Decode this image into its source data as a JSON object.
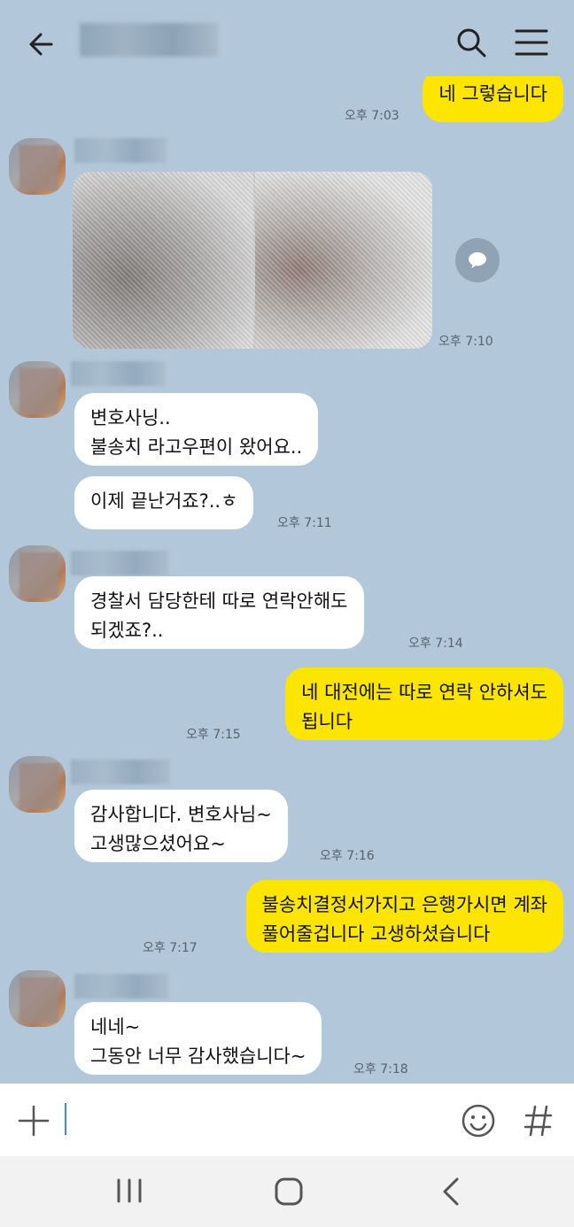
{
  "header": {
    "back_icon": "arrow-left-icon",
    "search_icon": "search-icon",
    "menu_icon": "hamburger-menu-icon"
  },
  "messages": [
    {
      "side": "me",
      "text": "네 그렇습니다",
      "time": "오후 7:03"
    },
    {
      "side": "them",
      "type": "photo",
      "time": "오후 7:10"
    },
    {
      "side": "them",
      "text": "변호사닝..\n불송치 라고우편이 왔어요..",
      "time": ""
    },
    {
      "side": "them",
      "text": "이제 끝난거죠?..ㅎ",
      "time": "오후 7:11"
    },
    {
      "side": "them",
      "text": "경찰서 담당한테 따로 연락안해도\n되겠죠?..",
      "time": "오후 7:14"
    },
    {
      "side": "me",
      "text": "네 대전에는 따로 연락 안하셔도\n됩니다",
      "time": "오후 7:15"
    },
    {
      "side": "them",
      "text": "감사합니다. 변호사님~\n고생많으셨어요~",
      "time": "오후 7:16"
    },
    {
      "side": "me",
      "text": "불송치결정서가지고 은행가시면 계좌\n풀어줄겁니다 고생하셨습니다",
      "time": "오후 7:17"
    },
    {
      "side": "them",
      "text": "네네~\n그동안 너무 감사했습니다~",
      "time": "오후 7:18"
    }
  ],
  "colors": {
    "background": "#b2c7d9",
    "my_bubble": "#fee500",
    "their_bubble": "#ffffff"
  },
  "input": {
    "plus_icon": "plus-icon",
    "emoji_icon": "emoji-icon",
    "hash_icon": "hash-icon"
  },
  "navbar": {
    "recent_icon": "recent-apps-icon",
    "home_icon": "home-icon",
    "back_icon": "nav-back-icon"
  }
}
